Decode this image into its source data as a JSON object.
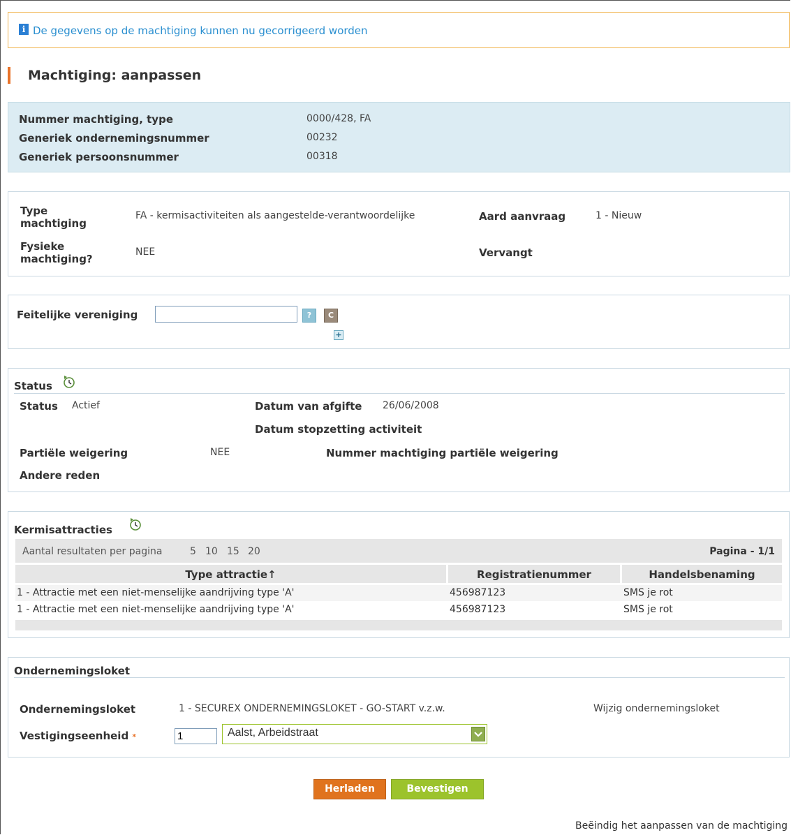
{
  "info_message": "De gegevens op de machtiging kunnen nu gecorrigeerd worden",
  "page_title": "Machtiging: aanpassen",
  "id_block": {
    "rows": [
      {
        "label": "Nummer machtiging, type",
        "value": "0000/428, FA"
      },
      {
        "label": "Generiek ondernemingsnummer",
        "value": "00232"
      },
      {
        "label": "Generiek persoonsnummer",
        "value": "00318"
      }
    ]
  },
  "type_block": {
    "type_label": "Type machtiging",
    "type_value": "FA - kermisactiviteiten als aangestelde-verantwoordelijke",
    "aard_label": "Aard aanvraag",
    "aard_value": "1 - Nieuw",
    "fysieke_label": "Fysieke machtiging?",
    "fysieke_value": "NEE",
    "vervangt_label": "Vervangt"
  },
  "vereniging": {
    "label": "Feitelijke vereniging",
    "input_value": "",
    "help_btn": "?",
    "clear_btn": "C",
    "add_btn": "+"
  },
  "status": {
    "section_title": "Status",
    "status_label": "Status",
    "status_value": "Actief",
    "afgifte_label": "Datum van afgifte",
    "afgifte_value": "26/06/2008",
    "stopzetting_label": "Datum stopzetting activiteit",
    "partiele_label": "Partiële weigering",
    "partiele_value": "NEE",
    "nummer_partiele_label": "Nummer machtiging partiële weigering",
    "andere_label": "Andere reden"
  },
  "kermis": {
    "section_title": "Kermisattracties",
    "per_page_label": "Aantal resultaten per pagina",
    "per_page_options": [
      "5",
      "10",
      "15",
      "20"
    ],
    "pagina": "Pagina - 1/1",
    "columns": [
      "Type attractie↑",
      "Registratienummer",
      "Handelsbenaming"
    ],
    "rows": [
      [
        "1 - Attractie met een niet-menselijke aandrijving type 'A'",
        "456987123",
        "SMS je rot"
      ],
      [
        "1 - Attractie met een niet-menselijke aandrijving type 'A'",
        "456987123",
        "SMS je rot"
      ]
    ]
  },
  "loket": {
    "section_title": "Ondernemingsloket",
    "loket_label": "Ondernemingsloket",
    "loket_value": "1 - SECUREX ONDERNEMINGSLOKET - GO-START v.z.w.",
    "wijzig_link": "Wijzig ondernemingsloket",
    "vestiging_label": "Vestigingseenheid",
    "required_mark": "*",
    "vestiging_code": "1",
    "vestiging_select": "Aalst, Arbeidstraat"
  },
  "buttons": {
    "herladen": "Herladen",
    "bevestigen": "Bevestigen"
  },
  "footer_link": "Beëindig het aanpassen van de machtiging",
  "colors": {
    "accent_orange": "#e8732a",
    "confirm_green": "#9cc32c",
    "info_blue": "#2a8fd0"
  }
}
